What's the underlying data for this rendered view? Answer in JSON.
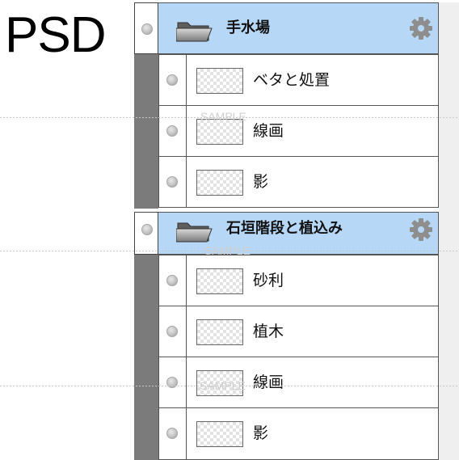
{
  "title": "PSD",
  "watermark": "SAMPLE",
  "groups": [
    {
      "name": "手水場",
      "layers": [
        {
          "name": "ベタと処置"
        },
        {
          "name": "線画"
        },
        {
          "name": "影"
        }
      ]
    },
    {
      "name": "石垣階段と植込み",
      "layers": [
        {
          "name": "砂利"
        },
        {
          "name": "植木"
        },
        {
          "name": "線画"
        },
        {
          "name": "影"
        }
      ]
    }
  ],
  "icons": {
    "visibility": "visibility-dot-icon",
    "folder": "folder-icon",
    "settings": "gear-icon"
  },
  "colors": {
    "group_header": "#b7d7f6",
    "layer_indent": "#7b7b7b"
  }
}
